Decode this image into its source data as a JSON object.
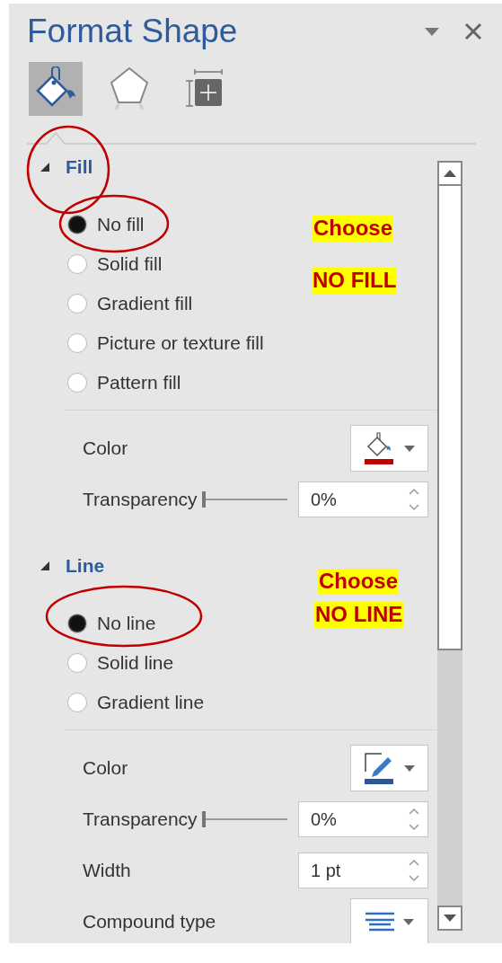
{
  "panel": {
    "title": "Format Shape",
    "tabs": [
      {
        "kind": "fill",
        "selected": true
      },
      {
        "kind": "effects",
        "selected": false
      },
      {
        "kind": "layout",
        "selected": false
      }
    ]
  },
  "sections": [
    {
      "title": "Fill",
      "expanded": true,
      "options": [
        {
          "label": "No fill",
          "selected": true
        },
        {
          "label": "Solid fill",
          "selected": false
        },
        {
          "label": "Gradient fill",
          "selected": false
        },
        {
          "label": "Picture or texture fill",
          "selected": false
        },
        {
          "label": "Pattern fill",
          "selected": false
        }
      ],
      "properties": [
        {
          "kind": "fill-color",
          "label": "Color",
          "color": "#c00000"
        },
        {
          "kind": "slider",
          "label": "Transparency",
          "level": 0,
          "value": "0%"
        }
      ]
    },
    {
      "title": "Line",
      "expanded": true,
      "options": [
        {
          "label": "No line",
          "selected": true
        },
        {
          "label": "Solid line",
          "selected": false
        },
        {
          "label": "Gradient line",
          "selected": false
        }
      ],
      "properties": [
        {
          "kind": "line-color",
          "label": "Color",
          "color": "#2b579a"
        },
        {
          "kind": "slider",
          "label": "Transparency",
          "level": 0,
          "value": "0%"
        },
        {
          "kind": "spinner",
          "label": "Width",
          "value": "1 pt"
        },
        {
          "kind": "compound",
          "label": "Compound type"
        }
      ]
    }
  ],
  "annotations": [
    {
      "text": "Choose"
    },
    {
      "text": "NO FILL"
    },
    {
      "text": "Choose"
    },
    {
      "text": "NO LINE"
    }
  ]
}
